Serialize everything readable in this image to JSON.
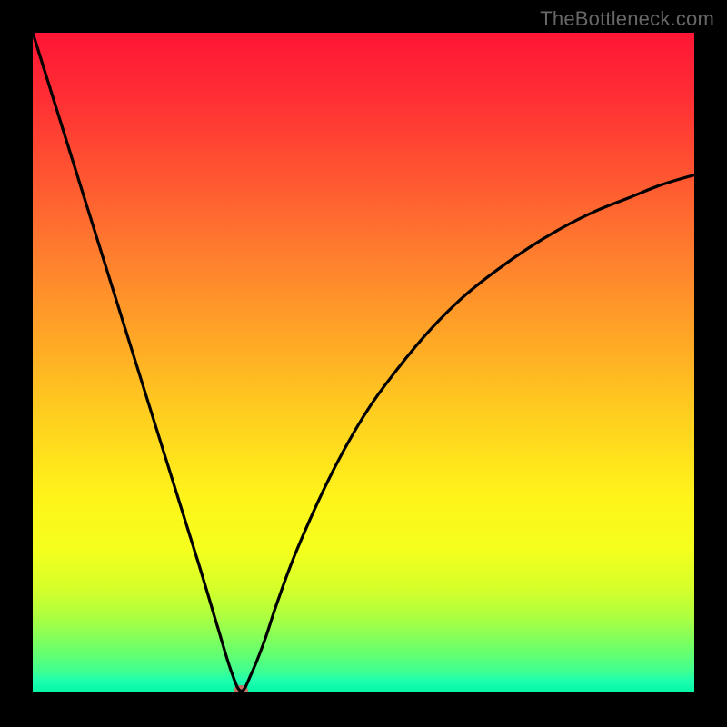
{
  "watermark": "TheBottleneck.com",
  "chart_data": {
    "type": "line",
    "title": "",
    "xlabel": "",
    "ylabel": "",
    "xlim": [
      0,
      100
    ],
    "ylim": [
      0,
      100
    ],
    "background_gradient": {
      "top": "#ff1535",
      "bottom": "#00f3a6",
      "note": "vertical gradient red→orange→yellow→green representing bottleneck severity (high at top, low at bottom)"
    },
    "series": [
      {
        "name": "bottleneck-curve",
        "note": "V-shaped curve; y≈0 at the minimum, left branch steeper than right",
        "x": [
          0,
          5,
          10,
          15,
          20,
          25,
          28,
          30,
          31.5,
          33,
          35,
          37,
          40,
          45,
          50,
          55,
          60,
          65,
          70,
          75,
          80,
          85,
          90,
          95,
          100
        ],
        "values": [
          100,
          84,
          68,
          52,
          36,
          20,
          10,
          3.5,
          0.5,
          3,
          8,
          14,
          22,
          33,
          42,
          49,
          55,
          60,
          64,
          67.5,
          70.5,
          73,
          75,
          77,
          78.5
        ]
      }
    ],
    "marker": {
      "name": "optimal-point",
      "x": 31.5,
      "y": 0.5,
      "color": "#c77263"
    }
  }
}
